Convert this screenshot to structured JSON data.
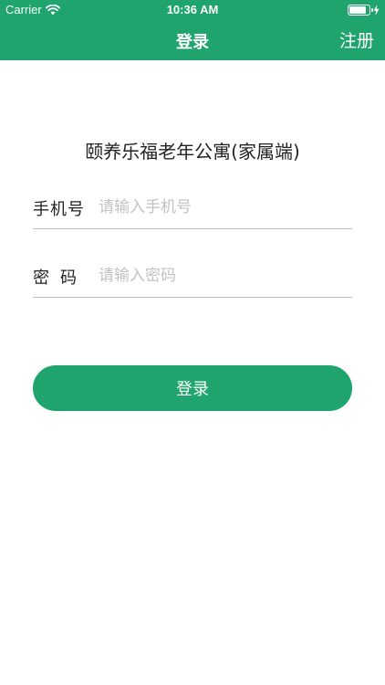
{
  "status_bar": {
    "carrier": "Carrier",
    "time": "10:36 AM",
    "battery_level": 0.88
  },
  "nav": {
    "title": "登录",
    "register_label": "注册"
  },
  "app_title": "颐养乐福老年公寓(家属端)",
  "form": {
    "phone": {
      "label": "手机号",
      "placeholder": "请输入手机号",
      "value": ""
    },
    "password": {
      "label": "密码",
      "placeholder": "请输入密码",
      "value": ""
    }
  },
  "login_button_label": "登录",
  "colors": {
    "brand": "#1ea46c"
  },
  "icons": [
    "wifi-icon",
    "battery-icon",
    "charging-bolt-icon"
  ]
}
